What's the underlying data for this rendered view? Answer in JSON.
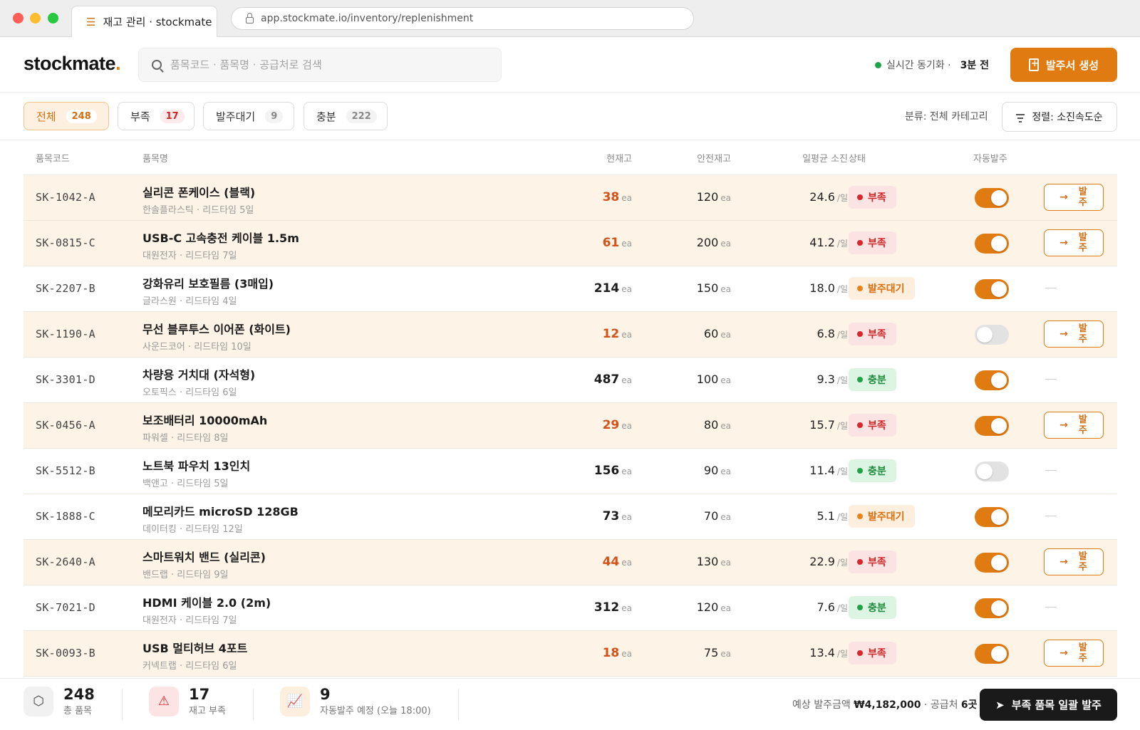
{
  "browser": {
    "tab_title": "재고 관리 · stockmate",
    "url": "app.stockmate.io/inventory/replenishment"
  },
  "header": {
    "logo_text": "stockmate",
    "logo_dot": ".",
    "search_placeholder": "품목코드 · 품목명 · 공급처로 검색",
    "sync_label": "실시간 동기화 ·",
    "sync_time": "3분 전",
    "create_button": "발주서 생성"
  },
  "filters": {
    "chips": [
      {
        "label": "전체",
        "count": "248"
      },
      {
        "label": "부족",
        "count": "17"
      },
      {
        "label": "발주대기",
        "count": "9"
      },
      {
        "label": "충분",
        "count": "222"
      }
    ],
    "category": "분류: 전체 카테고리",
    "sort": "정렬: 소진속도순"
  },
  "table": {
    "columns": [
      "품목코드",
      "품목명",
      "현재고",
      "안전재고",
      "일평균 소진",
      "상태",
      "자동발주"
    ],
    "unit_stock": "ea",
    "unit_daily": "/일",
    "order_label": "발주",
    "rows": [
      {
        "code": "SK-1042-A",
        "name": "실리콘 폰케이스 (블랙)",
        "sub": "한솔플라스틱 · 리드타임 5일",
        "stock": "38",
        "safe": "120",
        "daily": "24.6",
        "status": "부족",
        "auto": "on",
        "order": true
      },
      {
        "code": "SK-0815-C",
        "name": "USB-C 고속충전 케이블 1.5m",
        "sub": "대원전자 · 리드타임 7일",
        "stock": "61",
        "safe": "200",
        "daily": "41.2",
        "status": "부족",
        "auto": "on",
        "order": true
      },
      {
        "code": "SK-2207-B",
        "name": "강화유리 보호필름 (3매입)",
        "sub": "글라스원 · 리드타임 4일",
        "stock": "214",
        "safe": "150",
        "daily": "18.0",
        "status": "발주대기",
        "auto": "on",
        "order": false
      },
      {
        "code": "SK-1190-A",
        "name": "무선 블루투스 이어폰 (화이트)",
        "sub": "사운드코어 · 리드타임 10일",
        "stock": "12",
        "safe": "60",
        "daily": "6.8",
        "status": "부족",
        "auto": "off",
        "order": true
      },
      {
        "code": "SK-3301-D",
        "name": "차량용 거치대 (자석형)",
        "sub": "오토픽스 · 리드타임 6일",
        "stock": "487",
        "safe": "100",
        "daily": "9.3",
        "status": "충분",
        "auto": "on",
        "order": false
      },
      {
        "code": "SK-0456-A",
        "name": "보조배터리 10000mAh",
        "sub": "파워셀 · 리드타임 8일",
        "stock": "29",
        "safe": "80",
        "daily": "15.7",
        "status": "부족",
        "auto": "on",
        "order": true
      },
      {
        "code": "SK-5512-B",
        "name": "노트북 파우치 13인치",
        "sub": "백앤고 · 리드타임 5일",
        "stock": "156",
        "safe": "90",
        "daily": "11.4",
        "status": "충분",
        "auto": "off",
        "order": false
      },
      {
        "code": "SK-1888-C",
        "name": "메모리카드 microSD 128GB",
        "sub": "데이터킹 · 리드타임 12일",
        "stock": "73",
        "safe": "70",
        "daily": "5.1",
        "status": "발주대기",
        "auto": "on",
        "order": false
      },
      {
        "code": "SK-2640-A",
        "name": "스마트워치 밴드 (실리콘)",
        "sub": "밴드랩 · 리드타임 9일",
        "stock": "44",
        "safe": "130",
        "daily": "22.9",
        "status": "부족",
        "auto": "on",
        "order": true
      },
      {
        "code": "SK-7021-D",
        "name": "HDMI 케이블 2.0 (2m)",
        "sub": "대원전자 · 리드타임 7일",
        "stock": "312",
        "safe": "120",
        "daily": "7.6",
        "status": "충분",
        "auto": "on",
        "order": false
      },
      {
        "code": "SK-0093-B",
        "name": "USB 멀티허브 4포트",
        "sub": "커넥트랩 · 리드타임 6일",
        "stock": "18",
        "safe": "75",
        "daily": "13.4",
        "status": "부족",
        "auto": "on",
        "order": true
      }
    ]
  },
  "footer": {
    "stats": [
      {
        "value": "248",
        "label": "총 품목",
        "icon": "box-icon"
      },
      {
        "value": "17",
        "label": "재고 부족",
        "icon": "warning-icon"
      },
      {
        "value": "9",
        "label": "자동발주 예정 (오늘 18:00)",
        "icon": "chart-icon"
      }
    ],
    "est_label": "예상 발주금액",
    "est_amount": "₩4,182,000",
    "supplier_label": "· 공급처",
    "supplier_count": "6곳",
    "bulk_button": "부족 품목 일괄 발주"
  },
  "colors": {
    "accent": "#e07b12",
    "short": "#cc2727",
    "wait": "#d96f0d",
    "ok": "#1c8b3c",
    "low_row_bg": "#fdf3e6"
  }
}
